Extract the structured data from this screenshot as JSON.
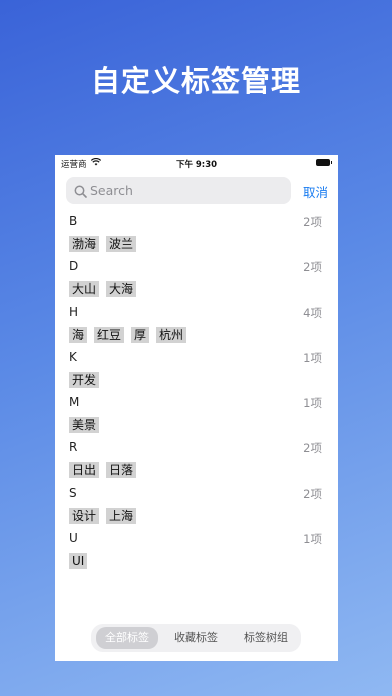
{
  "headline": "自定义标签管理",
  "statusbar": {
    "carrier": "运营商",
    "time": "下午 9:30"
  },
  "search": {
    "placeholder": "Search",
    "cancel": "取消"
  },
  "sections": [
    {
      "letter": "B",
      "count": "2项",
      "tags": [
        "渤海",
        "波兰"
      ]
    },
    {
      "letter": "D",
      "count": "2项",
      "tags": [
        "大山",
        "大海"
      ]
    },
    {
      "letter": "H",
      "count": "4项",
      "tags": [
        "海",
        "红豆",
        "厚",
        "杭州"
      ]
    },
    {
      "letter": "K",
      "count": "1项",
      "tags": [
        "开发"
      ]
    },
    {
      "letter": "M",
      "count": "1项",
      "tags": [
        "美景"
      ]
    },
    {
      "letter": "R",
      "count": "2项",
      "tags": [
        "日出",
        "日落"
      ]
    },
    {
      "letter": "S",
      "count": "2项",
      "tags": [
        "设计",
        "上海"
      ]
    },
    {
      "letter": "U",
      "count": "1项",
      "tags": [
        "UI"
      ]
    }
  ],
  "tabs": [
    {
      "label": "全部标签",
      "active": true
    },
    {
      "label": "收藏标签",
      "active": false
    },
    {
      "label": "标签树组",
      "active": false
    }
  ],
  "icons": {
    "search": "search-icon",
    "wifi": "wifi-icon",
    "battery": "battery-icon"
  },
  "colors": {
    "accent": "#1a7cf0",
    "chip": "#d2d2d2"
  }
}
